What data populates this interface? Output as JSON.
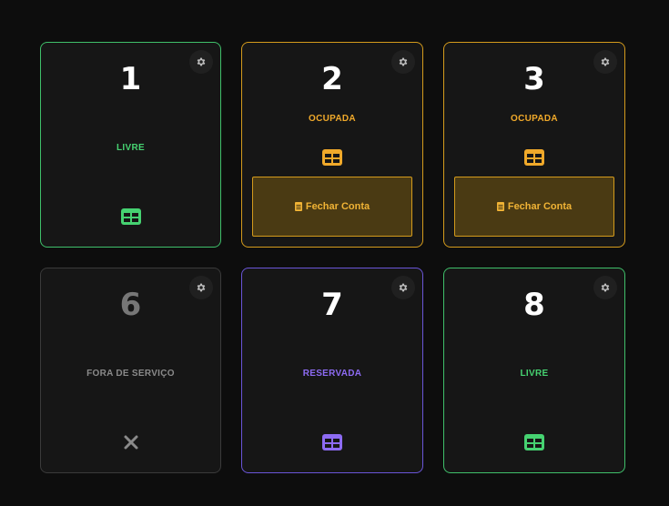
{
  "tables": [
    {
      "number": "1",
      "status": "LIVRE",
      "state": "livre"
    },
    {
      "number": "2",
      "status": "OCUPADA",
      "state": "ocupada",
      "action_label": "Fechar Conta"
    },
    {
      "number": "3",
      "status": "OCUPADA",
      "state": "ocupada",
      "action_label": "Fechar Conta"
    },
    {
      "number": "6",
      "status": "FORA DE SERVIÇO",
      "state": "fora"
    },
    {
      "number": "7",
      "status": "RESERVADA",
      "state": "reservada"
    },
    {
      "number": "8",
      "status": "LIVRE",
      "state": "livre"
    }
  ],
  "colors": {
    "livre": "#46d271",
    "ocupada": "#f0a92a",
    "reservada": "#8d6bf3",
    "fora": "#8a8a8a",
    "background": "#0d0d0d"
  },
  "icons": {
    "settings": "gear-icon",
    "table": "table-icon",
    "out_of_service": "close-icon",
    "bill": "document-icon"
  }
}
